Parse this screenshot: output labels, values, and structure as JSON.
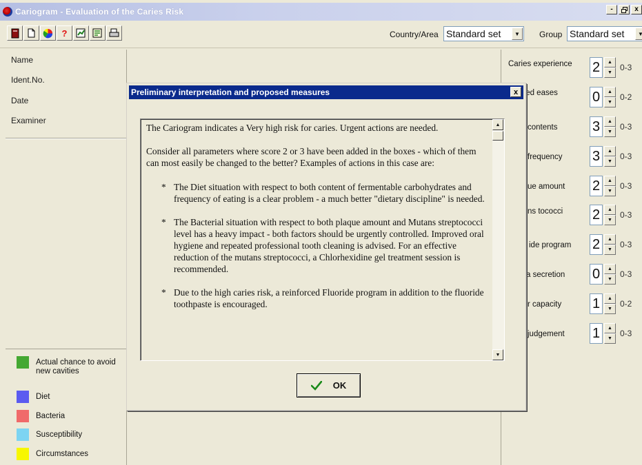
{
  "window": {
    "title": "Cariogram - Evaluation of the Caries Risk",
    "controls": {
      "minimize": "-",
      "restore": "ѥ",
      "close": "x"
    }
  },
  "toolbar": {
    "country_label": "Country/Area",
    "country_value": "Standard set",
    "group_label": "Group",
    "group_value": "Standard set",
    "help_glyph": "?",
    "icons": [
      "book-icon",
      "new-document-icon",
      "pie-chart-icon",
      "help-icon",
      "edit-chart-icon",
      "text-icon",
      "print-icon"
    ]
  },
  "patient": {
    "fields": [
      "Name",
      "Ident.No.",
      "Date",
      "Examiner"
    ]
  },
  "legend": [
    {
      "label": "Actual chance to avoid new cavities",
      "color": "#44a832"
    },
    {
      "label": "Diet",
      "color": "#5b5bf0"
    },
    {
      "label": "Bacteria",
      "color": "#f06a6a"
    },
    {
      "label": "Susceptibility",
      "color": "#7dd4f2"
    },
    {
      "label": "Circumstances",
      "color": "#f7f700"
    }
  ],
  "parameters": [
    {
      "label": "Caries experience",
      "value": "2",
      "range": "0-3"
    },
    {
      "label": "ted eases",
      "value": "0",
      "range": "0-2"
    },
    {
      "label": "contents",
      "value": "3",
      "range": "0-3"
    },
    {
      "label": "frequency",
      "value": "3",
      "range": "0-3"
    },
    {
      "label": "ue amount",
      "value": "2",
      "range": "0-3"
    },
    {
      "label": "ns tococci",
      "value": "2",
      "range": "0-3"
    },
    {
      "label": "ide program",
      "value": "2",
      "range": "0-3"
    },
    {
      "label": "a secretion",
      "value": "0",
      "range": "0-3"
    },
    {
      "label": "r capacity",
      "value": "1",
      "range": "0-2"
    },
    {
      "label": "judgement",
      "value": "1",
      "range": "0-3"
    }
  ],
  "dialog": {
    "title": "Preliminary interpretation and proposed measures",
    "close_glyph": "x",
    "paragraphs": [
      "The Cariogram indicates a Very high risk for caries. Urgent actions are needed.",
      "Consider all parameters where score 2 or 3 have been added in the boxes - which of them can most easily be changed to the better? Examples of actions in this case are:"
    ],
    "bullets": [
      "The Diet situation with respect to both content of fermentable carbohydrates and frequency of eating is a clear problem - a much better \"dietary discipline\" is needed.",
      "The Bacterial situation with respect to both plaque amount and Mutans streptococci level has a heavy impact - both factors should be urgently controlled. Improved oral hygiene and repeated professional tooth cleaning is advised. For an effective reduction of the mutans streptococci, a Chlorhexidine gel treatment session is recommended.",
      "Due to the high caries risk, a reinforced Fluoride program in addition to the fluoride toothpaste is encouraged."
    ],
    "bullet_glyph": "*",
    "ok_label": "OK"
  }
}
